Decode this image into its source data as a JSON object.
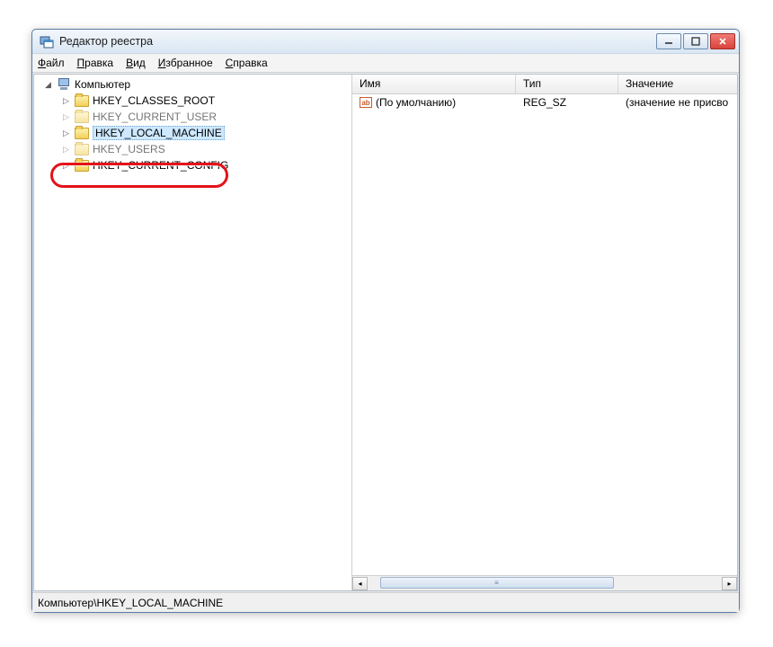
{
  "window": {
    "title": "Редактор реестра"
  },
  "menu": {
    "file": {
      "label": "Файл",
      "ul": "Ф"
    },
    "edit": {
      "label": "Правка",
      "ul": "П"
    },
    "view": {
      "label": "Вид",
      "ul": "В"
    },
    "favorites": {
      "label": "Избранное",
      "ul": "И"
    },
    "help": {
      "label": "Справка",
      "ul": "С"
    }
  },
  "tree": {
    "root": "Компьютер",
    "items": [
      {
        "label": "HKEY_CLASSES_ROOT"
      },
      {
        "label": "HKEY_CURRENT_USER",
        "partially_hidden": "top"
      },
      {
        "label": "HKEY_LOCAL_MACHINE",
        "selected": true,
        "highlighted": true
      },
      {
        "label": "HKEY_USERS",
        "partially_hidden": "bottom"
      },
      {
        "label": "HKEY_CURRENT_CONFIG"
      }
    ]
  },
  "list": {
    "columns": {
      "name": "Имя",
      "type": "Тип",
      "value": "Значение"
    },
    "rows": [
      {
        "name": "(По умолчанию)",
        "type": "REG_SZ",
        "value": "(значение не присво"
      }
    ]
  },
  "statusbar": {
    "path": "Компьютер\\HKEY_LOCAL_MACHINE"
  },
  "icons": {
    "reg_string": "ab"
  }
}
